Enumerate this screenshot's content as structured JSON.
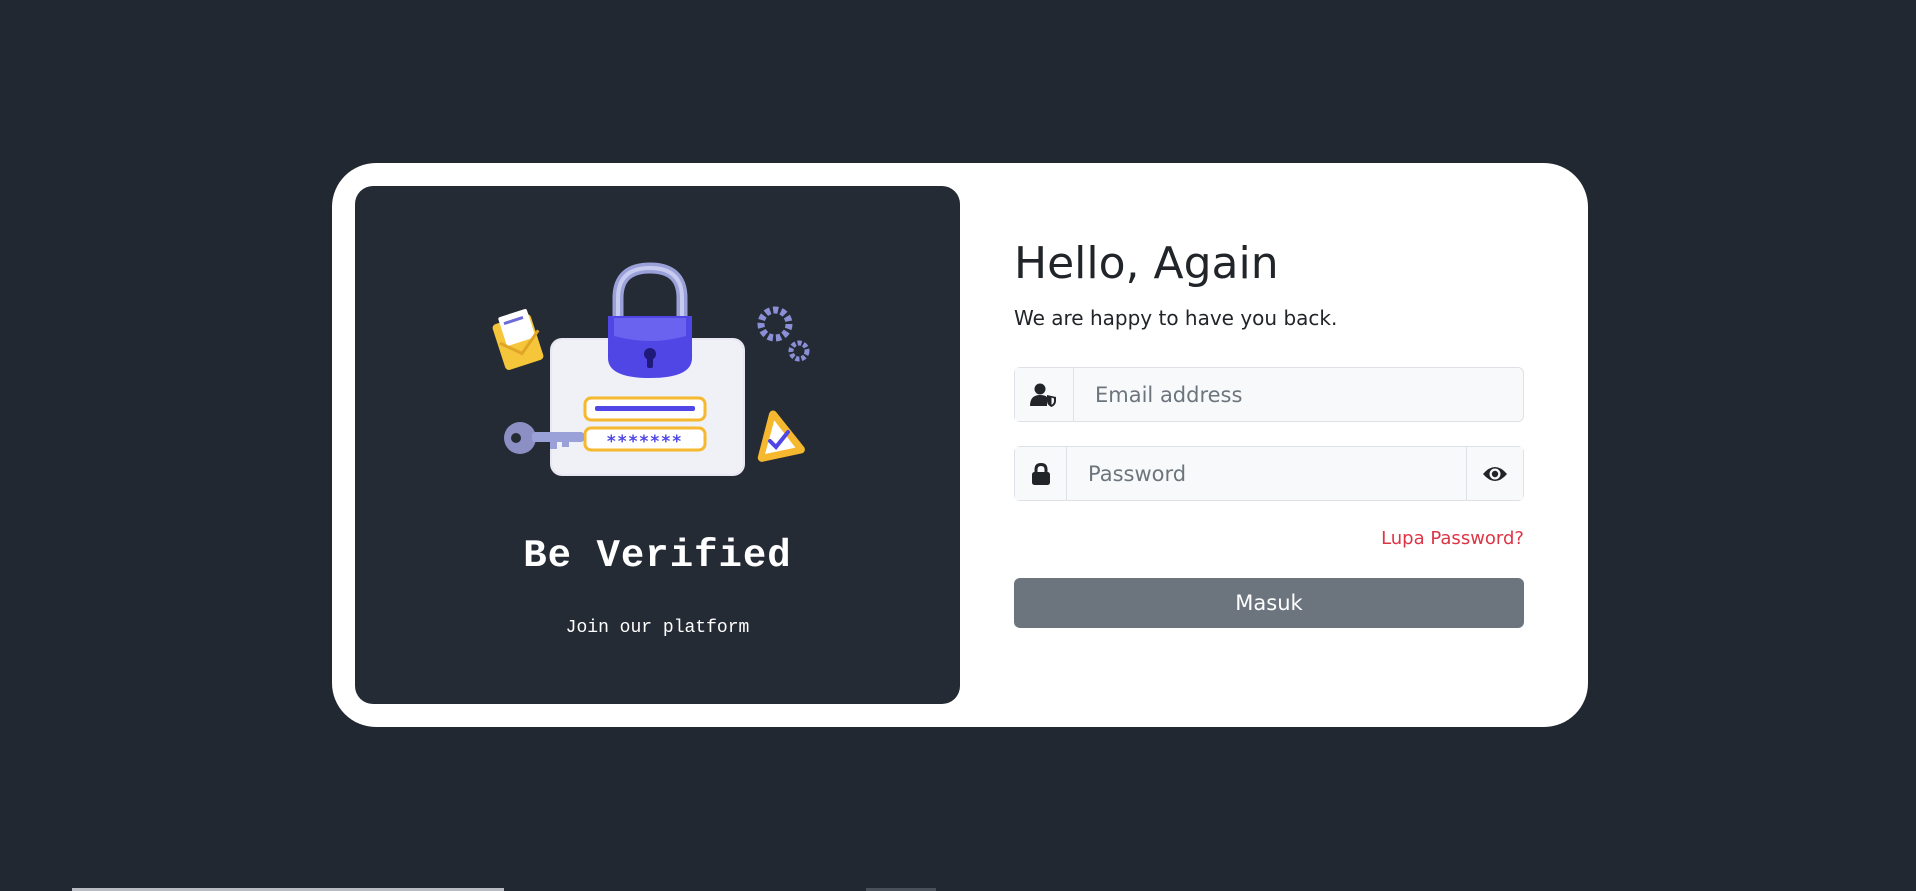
{
  "colors": {
    "page_background": "#222831",
    "card_background": "#ffffff",
    "left_panel_background": "#252b35",
    "accent_purple": "#4f46e5",
    "accent_yellow": "#f5b82e",
    "forgot_link": "#dc3545",
    "button_background": "#6c757d"
  },
  "left_panel": {
    "illustration": "login-security-illustration",
    "illustration_field_mask": "*******",
    "title": "Be Verified",
    "subtitle": "Join our platform"
  },
  "login": {
    "heading": "Hello, Again",
    "subheading": "We are happy to have you back.",
    "email": {
      "icon": "user-shield-icon",
      "placeholder": "Email address",
      "value": ""
    },
    "password": {
      "icon": "lock-icon",
      "placeholder": "Password",
      "value": "",
      "toggle_icon": "eye-icon"
    },
    "forgot_password_label": "Lupa Password?",
    "submit_label": "Masuk"
  }
}
